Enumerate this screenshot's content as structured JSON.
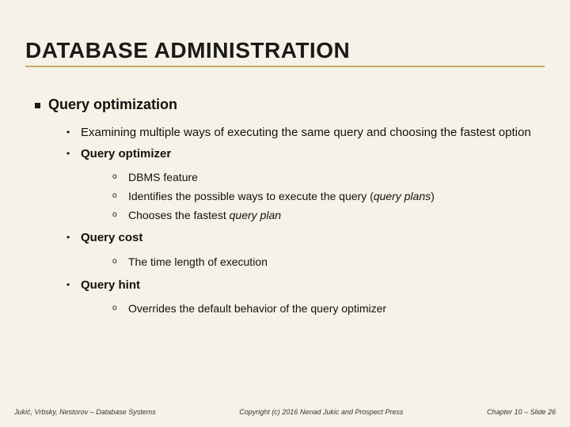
{
  "title": "DATABASE ADMINISTRATION",
  "section": "Query optimization",
  "b1": "Examining multiple ways of executing the same query and choosing the fastest option",
  "b2": "Query optimizer",
  "b2_sub1": "DBMS feature",
  "b2_sub2_a": "Identifies the possible ways to execute the query (",
  "b2_sub2_i": "query plans",
  "b2_sub2_b": ")",
  "b2_sub3_a": "Chooses the fastest ",
  "b2_sub3_i": "query plan",
  "b3": "Query cost",
  "b3_sub1": "The time length of execution",
  "b4": "Query hint",
  "b4_sub1": "Overrides the default behavior of the query optimizer",
  "footer_left": "Jukić, Vrbsky, Nestorov – Database Systems",
  "footer_center": "Copyright (c) 2016 Nenad Jukic and Prospect Press",
  "footer_right": "Chapter 10 – Slide 26"
}
